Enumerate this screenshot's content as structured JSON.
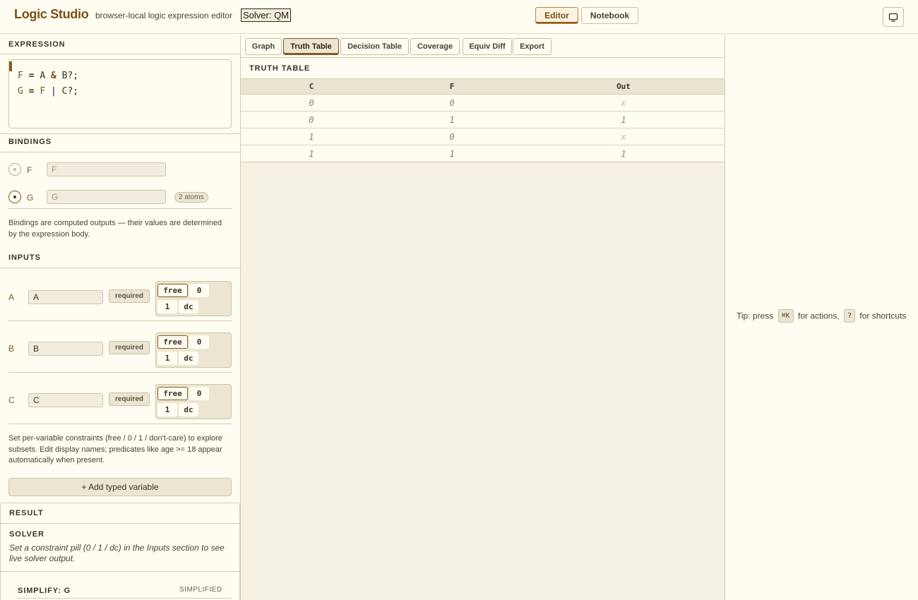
{
  "header": {
    "title": "Logic Studio",
    "subtitle": "browser-local logic expression editor",
    "solver_label": "Solver: QM",
    "modes": [
      "Editor",
      "Notebook"
    ],
    "active_mode": "Editor",
    "display_icon": "monitor-icon"
  },
  "expression": {
    "title": "EXPRESSION",
    "lines": [
      "F = A & B?;",
      "G = F | C?;"
    ]
  },
  "bindings": {
    "title": "BINDINGS",
    "items": [
      {
        "name": "F",
        "placeholder": "F",
        "selected": false
      },
      {
        "name": "G",
        "placeholder": "G",
        "selected": true,
        "badge": "2 atoms"
      }
    ],
    "note": "Bindings are computed outputs — their values are determined by the expression body."
  },
  "inputs": {
    "title": "INPUTS",
    "required_label": "required",
    "pills": [
      "free",
      "0",
      "1",
      "dc"
    ],
    "items": [
      {
        "name": "A",
        "value": "A",
        "constraint": "free"
      },
      {
        "name": "B",
        "value": "B",
        "constraint": "free"
      },
      {
        "name": "C",
        "value": "C",
        "constraint": "free"
      }
    ],
    "note": "Set per-variable constraints (free / 0 / 1 / don't-care) to explore subsets. Edit display names; predicates like age  >=  18 appear automatically when present.",
    "add_label": "+ Add typed variable"
  },
  "result": {
    "title": "RESULT",
    "solver_title": "SOLVER",
    "solver_message": "Set a constraint pill (0 / 1 / dc) in the Inputs section to see live solver output.",
    "simplify_title": "SIMPLIFY: G",
    "simplify_status": "SIMPLIFIED"
  },
  "tabs": [
    "Graph",
    "Truth Table",
    "Decision Table",
    "Coverage",
    "Equiv Diff",
    "Export"
  ],
  "active_tab": "Truth Table",
  "truth_table": {
    "title": "TRUTH TABLE",
    "columns": [
      "C",
      "F",
      "Out"
    ],
    "rows": [
      [
        "0",
        "0",
        "x"
      ],
      [
        "0",
        "1",
        "1"
      ],
      [
        "1",
        "0",
        "x"
      ],
      [
        "1",
        "1",
        "1"
      ]
    ]
  },
  "tip": {
    "prefix": "Tip: press",
    "key1": "⌘K",
    "middle": "for actions,",
    "key2": "?",
    "suffix": "for shortcuts"
  },
  "colors": {
    "accent": "#7a4f14",
    "background": "#fffcf2",
    "out_dc": "#d9b48a",
    "out_true": "#6a9a82"
  }
}
